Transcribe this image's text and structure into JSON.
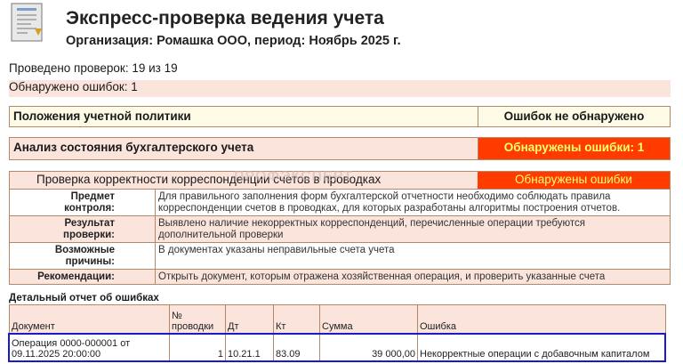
{
  "header": {
    "title": "Экспресс-проверка ведения учета",
    "subtitle": "Организация: Ромашка ООО, период: Ноябрь 2025 г.",
    "icon": "document-report-icon"
  },
  "summary": {
    "checks_done": "Проведено проверок: 19 из 19",
    "errors_found": "Обнаружено ошибок: 1"
  },
  "sections": [
    {
      "name": "Положения учетной политики",
      "status": "Ошибок не обнаружено"
    },
    {
      "name": "Анализ состояния бухгалтерского учета",
      "status": "Обнаружены ошибки: 1"
    }
  ],
  "check": {
    "name": "Проверка корректности корреспонденции счетов в проводках",
    "status": "Обнаружены ошибки",
    "watermark": "ПРОФЭКСПЕРТ"
  },
  "details": [
    {
      "label": "Предмет\nконтроля:",
      "text": "Для правильного заполнения форм бухгалтерской отчетности необходимо соблюдать правила корреспонденции счетов в проводках, для которых разработаны алгоритмы построения отчетов."
    },
    {
      "label": "Результат\nпроверки:",
      "text": "Выявлено наличие некорректных корреспонденций, перечисленные операции требуются дополнительной проверки"
    },
    {
      "label": "Возможные\nпричины:",
      "text": "В документах указаны неправильные счета учета"
    },
    {
      "label": "Рекомендации:",
      "text": "Открыть документ, которым отражена хозяйственная операция, и проверить указанные счета"
    }
  ],
  "report": {
    "caption": "Детальный отчет об ошибках",
    "columns": [
      "Документ",
      "№\nпроводки",
      "Дт",
      "Кт",
      "Сумма",
      "Ошибка"
    ],
    "rows": [
      {
        "doc": "Операция 0000-000001 от\n09.11.2025 20:00:00",
        "no": "1",
        "dt": "10.21.1",
        "kt": "83.09",
        "sum": "39 000,00",
        "error": "Некорректные операции с добавочным капиталом"
      }
    ]
  },
  "colors": {
    "accent_error": "#ff3b00",
    "error_text": "#ffff66",
    "shade": "#fbe4dc",
    "highlight": "#1a1acc"
  }
}
